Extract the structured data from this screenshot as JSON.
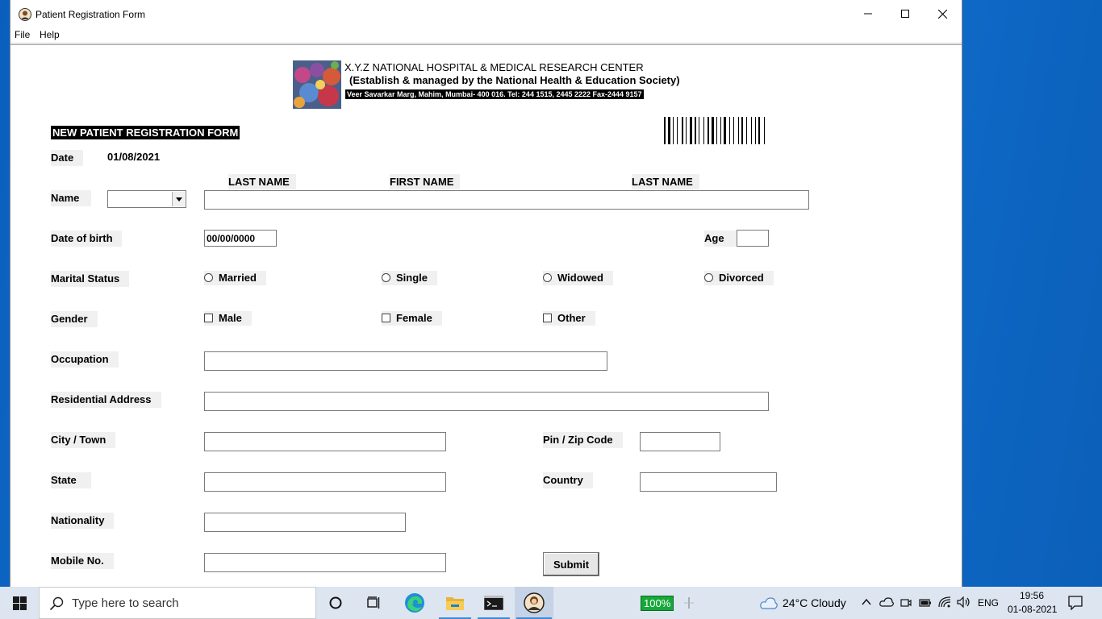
{
  "window": {
    "title": "Patient Registration Form"
  },
  "menu": {
    "file": "File",
    "help": "Help"
  },
  "header": {
    "hospital_name": "X.Y.Z NATIONAL HOSPITAL & MEDICAL RESEARCH CENTER",
    "subtitle": "(Establish & managed by the National Health & Education Society)",
    "address": "Veer Savarkar Marg, Mahim, Mumbai- 400 016.  Tel: 244 1515, 2445 2222 Fax-2444 9157"
  },
  "form": {
    "title": "NEW PATIENT REGISTRATION FORM",
    "date_label": "Date",
    "date_value": "01/08/2021",
    "name_columns": [
      "LAST NAME",
      "FIRST NAME",
      "LAST NAME"
    ],
    "name_label": "Name",
    "name_value": "",
    "title_select_value": "",
    "dob_label": "Date of birth",
    "dob_value": "00/00/0000",
    "age_label": "Age",
    "age_value": "",
    "marital_label": "Marital Status",
    "marital_options": [
      "Married",
      "Single",
      "Widowed",
      "Divorced"
    ],
    "gender_label": "Gender",
    "gender_options": [
      "Male",
      "Female",
      "Other"
    ],
    "occupation_label": "Occupation",
    "occupation_value": "",
    "address_label": "Residential Address",
    "address_value": "",
    "city_label": "City / Town",
    "city_value": "",
    "pin_label": "Pin / Zip Code",
    "pin_value": "",
    "state_label": "State",
    "state_value": "",
    "country_label": "Country",
    "country_value": "",
    "nationality_label": "Nationality",
    "nationality_value": "",
    "mobile_label": "Mobile No.",
    "mobile_value": "",
    "submit_label": "Submit"
  },
  "taskbar": {
    "search_placeholder": "Type here to search",
    "battery": "100%",
    "weather": "24°C  Cloudy",
    "language": "ENG",
    "time": "19:56",
    "date": "01-08-2021"
  },
  "icons": {
    "app": "user-avatar-icon",
    "start": "windows-start-icon",
    "search": "search-icon",
    "cortana": "cortana-icon",
    "task_view": "task-view-icon",
    "edge": "edge-icon",
    "explorer": "file-explorer-icon",
    "terminal": "terminal-icon",
    "app_taskbar": "user-avatar-icon"
  },
  "colors": {
    "desktop": "#0b63c4",
    "taskbar": "#dde5f0",
    "battery": "#17a83a",
    "label_bg": "#f0f0f0"
  }
}
